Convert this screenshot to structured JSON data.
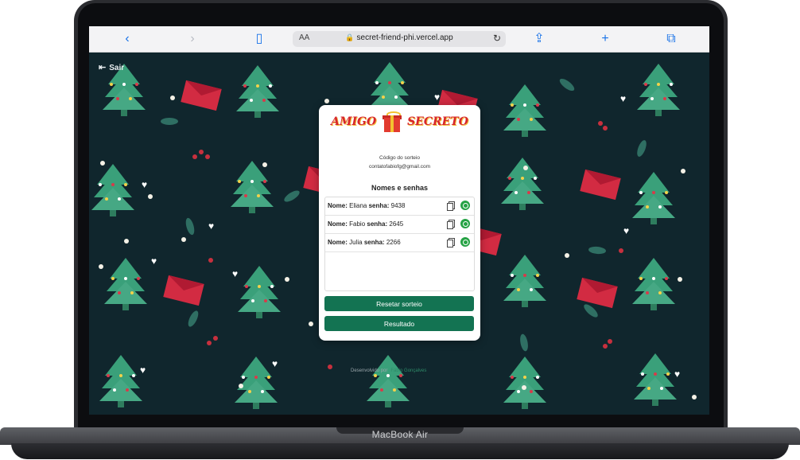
{
  "device": {
    "brand": "MacBook Air"
  },
  "browser": {
    "url": "secret-friend-phi.vercel.app",
    "text_size_label": "AA",
    "icons": [
      "back-icon",
      "forward-icon",
      "bookmarks-icon",
      "share-icon",
      "new-tab-icon",
      "tabs-icon"
    ]
  },
  "page": {
    "logout_label": "Sair",
    "logo": {
      "left": "AMIGO",
      "right": "SECRETO"
    },
    "code_label": "Código do sorteio",
    "code_value": "contatofabiofg@gmail.com",
    "heading": "Nomes e senhas",
    "name_label": "Nome:",
    "password_label": "senha:",
    "participants": [
      {
        "name": "Eliana",
        "password": "9438"
      },
      {
        "name": "Fabio",
        "password": "2645"
      },
      {
        "name": "Julia",
        "password": "2266"
      }
    ],
    "reset_button": "Resetar sorteio",
    "result_button": "Resultado",
    "footer_prefix": "Desenvolvido por",
    "footer_author": "Fábio Gonçalves"
  },
  "colors": {
    "background": "#10262d",
    "primary_button": "#137352",
    "accent_red": "#d7262c"
  }
}
